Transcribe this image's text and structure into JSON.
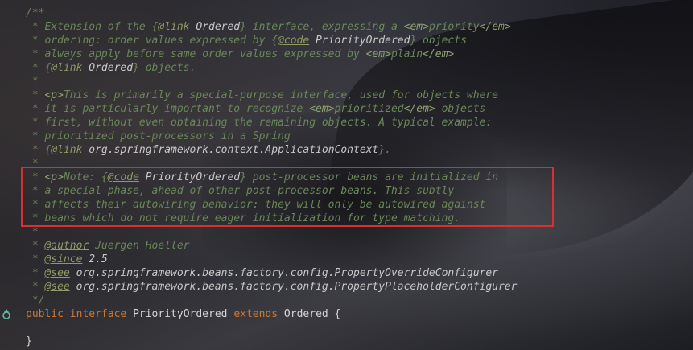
{
  "code_lines": [
    [
      {
        "t": "/**",
        "c": "cm"
      }
    ],
    [
      {
        "t": " * Extension of the ",
        "c": "cm"
      },
      {
        "t": "{",
        "c": "cm"
      },
      {
        "t": "@link",
        "c": "jd-tag"
      },
      {
        "t": " Ordered",
        "c": "ref"
      },
      {
        "t": "} interface, expressing a ",
        "c": "cm"
      },
      {
        "t": "<em>",
        "c": "tag"
      },
      {
        "t": "priority",
        "c": "cm"
      },
      {
        "t": "</em>",
        "c": "tag"
      }
    ],
    [
      {
        "t": " * ordering: order values expressed by ",
        "c": "cm"
      },
      {
        "t": "{",
        "c": "cm"
      },
      {
        "t": "@code",
        "c": "jd-tag"
      },
      {
        "t": " PriorityOrdered",
        "c": "ref"
      },
      {
        "t": "} objects",
        "c": "cm"
      }
    ],
    [
      {
        "t": " * always apply before same order values expressed by ",
        "c": "cm"
      },
      {
        "t": "<em>",
        "c": "tag"
      },
      {
        "t": "plain",
        "c": "cm"
      },
      {
        "t": "</em>",
        "c": "tag"
      }
    ],
    [
      {
        "t": " * ",
        "c": "cm"
      },
      {
        "t": "{",
        "c": "cm"
      },
      {
        "t": "@link",
        "c": "jd-tag"
      },
      {
        "t": " Ordered",
        "c": "ref"
      },
      {
        "t": "} objects.",
        "c": "cm"
      }
    ],
    [
      {
        "t": " *",
        "c": "cm"
      }
    ],
    [
      {
        "t": " * ",
        "c": "cm"
      },
      {
        "t": "<p>",
        "c": "tag"
      },
      {
        "t": "This is primarily a special-purpose interface, used for objects where",
        "c": "cm"
      }
    ],
    [
      {
        "t": " * it is particularly important to recognize ",
        "c": "cm"
      },
      {
        "t": "<em>",
        "c": "tag"
      },
      {
        "t": "prioritized",
        "c": "cm"
      },
      {
        "t": "</em>",
        "c": "tag"
      },
      {
        "t": " objects",
        "c": "cm"
      }
    ],
    [
      {
        "t": " * first, without even obtaining the remaining objects. A typical example:",
        "c": "cm"
      }
    ],
    [
      {
        "t": " * prioritized post-processors in a Spring",
        "c": "cm"
      }
    ],
    [
      {
        "t": " * ",
        "c": "cm"
      },
      {
        "t": "{",
        "c": "cm"
      },
      {
        "t": "@link",
        "c": "jd-tag"
      },
      {
        "t": " org.springframework.context.ApplicationContext",
        "c": "ref"
      },
      {
        "t": "}.",
        "c": "cm"
      }
    ],
    [
      {
        "t": " *",
        "c": "cm"
      }
    ],
    [
      {
        "t": " * ",
        "c": "cm"
      },
      {
        "t": "<p>",
        "c": "tag"
      },
      {
        "t": "Note: ",
        "c": "cm"
      },
      {
        "t": "{",
        "c": "cm"
      },
      {
        "t": "@code",
        "c": "jd-tag"
      },
      {
        "t": " PriorityOrdered",
        "c": "ref"
      },
      {
        "t": "} post-processor beans are initialized in",
        "c": "cm"
      }
    ],
    [
      {
        "t": " * a special phase, ahead of other post-processor beans. This subtly",
        "c": "cm"
      }
    ],
    [
      {
        "t": " * affects their autowiring behavior: they will only be autowired against",
        "c": "cm"
      }
    ],
    [
      {
        "t": " * beans which do not require eager initialization for type matching.",
        "c": "cm"
      }
    ],
    [
      {
        "t": " *",
        "c": "cm"
      }
    ],
    [
      {
        "t": " * ",
        "c": "cm"
      },
      {
        "t": "@author",
        "c": "jd-tag"
      },
      {
        "t": " Juergen Hoeller",
        "c": "jd-val"
      }
    ],
    [
      {
        "t": " * ",
        "c": "cm"
      },
      {
        "t": "@since",
        "c": "jd-tag"
      },
      {
        "t": " 2.5",
        "c": "ref"
      }
    ],
    [
      {
        "t": " * ",
        "c": "cm"
      },
      {
        "t": "@see",
        "c": "jd-tag"
      },
      {
        "t": " org.springframework.beans.factory.config.PropertyOverrideConfigurer",
        "c": "ref"
      }
    ],
    [
      {
        "t": " * ",
        "c": "cm"
      },
      {
        "t": "@see",
        "c": "jd-tag"
      },
      {
        "t": " org.springframework.beans.factory.config.PropertyPlaceholderConfigurer",
        "c": "ref"
      }
    ],
    [
      {
        "t": " */",
        "c": "cm"
      }
    ],
    [
      {
        "t": "public",
        "c": "kw"
      },
      {
        "t": " ",
        "c": "ident"
      },
      {
        "t": "interface",
        "c": "kw"
      },
      {
        "t": " PriorityOrdered ",
        "c": "ident"
      },
      {
        "t": "extends",
        "c": "kw"
      },
      {
        "t": " Ordered {",
        "c": "ident"
      }
    ],
    [
      {
        "t": "",
        "c": "ident"
      }
    ],
    [
      {
        "t": "}",
        "c": "ident"
      }
    ]
  ],
  "gutter": {
    "implemented_icon": "implemented-interface-icon",
    "icon_color": "#5fb8a0"
  },
  "highlight": {
    "color": "#d9302c"
  }
}
